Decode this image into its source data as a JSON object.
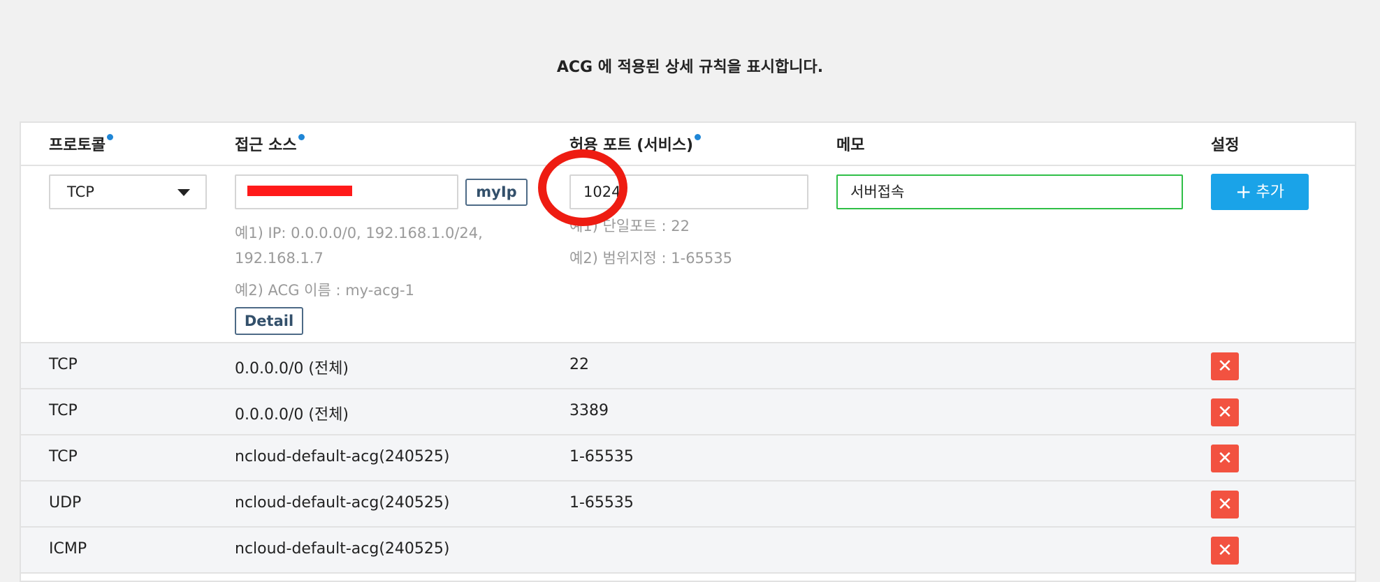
{
  "title": "ACG 에 적용된 상세 규칙을 표시합니다.",
  "columns": {
    "protocol": "프로토콜",
    "source": "접근 소스",
    "port": "허용 포트 (서비스)",
    "memo": "메모",
    "settings": "설정"
  },
  "form": {
    "protocol_value": "TCP",
    "source_value": "",
    "myip_label": "myIp",
    "source_hint_1": "예1) IP: 0.0.0.0/0, 192.168.1.0/24, 192.168.1.7",
    "source_hint_2": "예2) ACG 이름 : my-acg-1",
    "detail_label": "Detail",
    "port_value": "1024",
    "port_hint_1": "예1) 단일포트 : 22",
    "port_hint_2": "예2) 범위지정 : 1-65535",
    "memo_value": "서버접속",
    "add_label": "추가"
  },
  "rules": [
    {
      "protocol": "TCP",
      "source": "0.0.0.0/0 (전체)",
      "port": "22",
      "memo": ""
    },
    {
      "protocol": "TCP",
      "source": "0.0.0.0/0 (전체)",
      "port": "3389",
      "memo": ""
    },
    {
      "protocol": "TCP",
      "source": "ncloud-default-acg(240525)",
      "port": "1-65535",
      "memo": ""
    },
    {
      "protocol": "UDP",
      "source": "ncloud-default-acg(240525)",
      "port": "1-65535",
      "memo": ""
    },
    {
      "protocol": "ICMP",
      "source": "ncloud-default-acg(240525)",
      "port": "",
      "memo": ""
    }
  ],
  "icons": {
    "add": "plus-icon",
    "delete": "close-icon",
    "dropdown": "caret-down-icon",
    "required": "required-dot-icon"
  },
  "colors": {
    "accent": "#1aa3e8",
    "delete": "#f25240",
    "memo_border": "#2fbf47",
    "annotation": "#ee1c12",
    "required_dot": "#1f86d6"
  }
}
